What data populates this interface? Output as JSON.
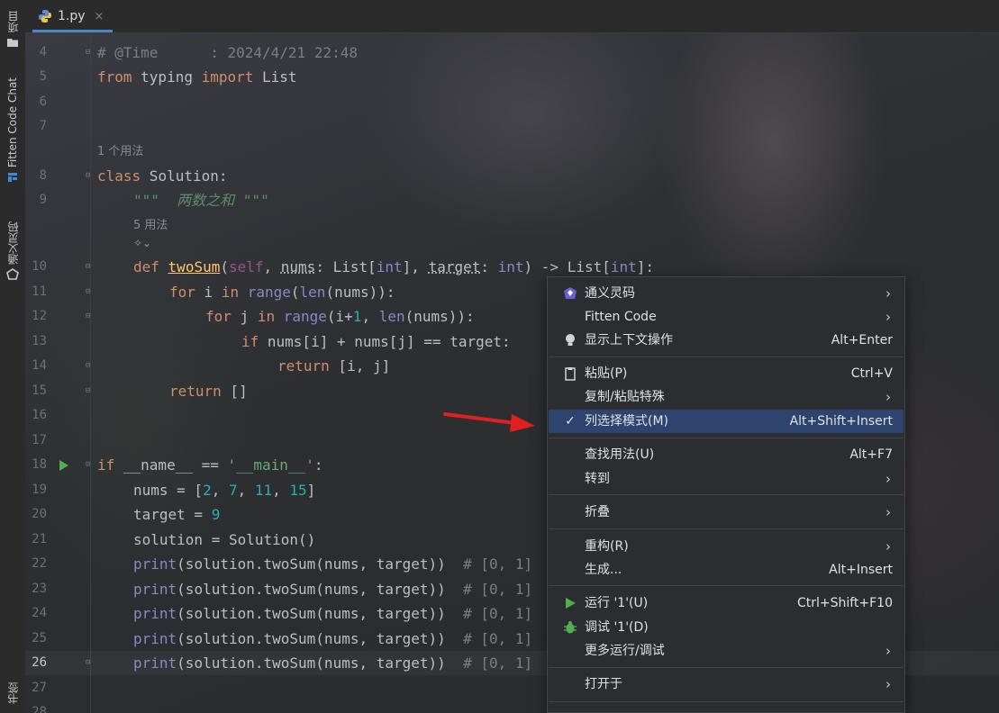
{
  "left_strip": {
    "project_label": "项目",
    "fitten_label": "Fitten Code Chat",
    "tongyi_label": "通义灵码",
    "bookmarks_label": "书签"
  },
  "tab": {
    "filename": "1.py",
    "close": "×"
  },
  "editor": {
    "lines": [
      {
        "n": "4"
      },
      {
        "n": "5"
      },
      {
        "n": "6"
      },
      {
        "n": "7"
      },
      {
        "n": "8"
      },
      {
        "n": "9"
      },
      {
        "n": "10"
      },
      {
        "n": "11"
      },
      {
        "n": "12"
      },
      {
        "n": "13"
      },
      {
        "n": "14"
      },
      {
        "n": "15"
      },
      {
        "n": "16"
      },
      {
        "n": "17"
      },
      {
        "n": "18"
      },
      {
        "n": "19"
      },
      {
        "n": "20"
      },
      {
        "n": "21"
      },
      {
        "n": "22"
      },
      {
        "n": "23"
      },
      {
        "n": "24"
      },
      {
        "n": "25"
      },
      {
        "n": "26"
      },
      {
        "n": "27"
      },
      {
        "n": "28"
      }
    ],
    "hint_usages_class": "1 个用法",
    "hint_usages_method": "5 用法",
    "time_comment": "# @Time      : 2024/4/21 22:48",
    "docstring_text": "\"\"\"  两数之和 \"\"\"",
    "comment_result": "# [0, 1]",
    "main_string": "'__main__'"
  },
  "menu": {
    "items": [
      {
        "label": "通义灵码",
        "shortcut": "",
        "arrow": "›",
        "icon": "tongyi-icon"
      },
      {
        "label": "Fitten Code",
        "shortcut": "",
        "arrow": "›",
        "icon": ""
      },
      {
        "label": "显示上下文操作",
        "shortcut": "Alt+Enter",
        "arrow": "",
        "icon": "bulb-icon"
      },
      {
        "label": "粘贴(P)",
        "shortcut": "Ctrl+V",
        "arrow": "",
        "icon": "clipboard-icon"
      },
      {
        "label": "复制/粘贴特殊",
        "shortcut": "",
        "arrow": "›",
        "icon": ""
      },
      {
        "label": "列选择模式(M)",
        "shortcut": "Alt+Shift+Insert",
        "arrow": "",
        "icon": "check-icon"
      },
      {
        "label": "查找用法(U)",
        "shortcut": "Alt+F7",
        "arrow": "",
        "icon": ""
      },
      {
        "label": "转到",
        "shortcut": "",
        "arrow": "›",
        "icon": ""
      },
      {
        "label": "折叠",
        "shortcut": "",
        "arrow": "›",
        "icon": ""
      },
      {
        "label": "重构(R)",
        "shortcut": "",
        "arrow": "›",
        "icon": ""
      },
      {
        "label": "生成...",
        "shortcut": "Alt+Insert",
        "arrow": "",
        "icon": ""
      },
      {
        "label": "运行 '1'(U)",
        "shortcut": "Ctrl+Shift+F10",
        "arrow": "",
        "icon": "run-icon"
      },
      {
        "label": "调试 '1'(D)",
        "shortcut": "",
        "arrow": "",
        "icon": "debug-icon"
      },
      {
        "label": "更多运行/调试",
        "shortcut": "",
        "arrow": "›",
        "icon": ""
      },
      {
        "label": "打开于",
        "shortcut": "",
        "arrow": "›",
        "icon": ""
      }
    ],
    "selected_index": 5
  },
  "colors": {
    "accent": "#2e436e",
    "keyword": "#cf8e6d",
    "string": "#6aab73",
    "number": "#2aacb8",
    "arrow": "#e02020"
  }
}
